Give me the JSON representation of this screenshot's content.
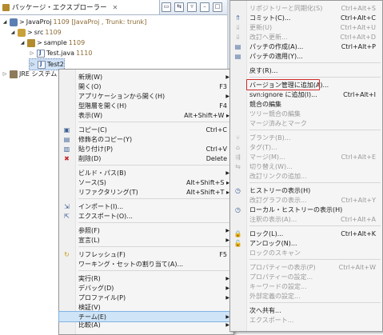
{
  "view": {
    "title": "パッケージ・エクスプローラー",
    "close": "✕"
  },
  "tree": {
    "project": {
      "prefix": "> ",
      "name": "JavaProj",
      "rev": "1109 [JavaProj , Trunk: trunk]"
    },
    "src": {
      "prefix": "> ",
      "name": "src",
      "rev": "1109"
    },
    "pkg": {
      "prefix": "> ",
      "name": "sample",
      "rev": "1109"
    },
    "file1": {
      "name": "Test.java",
      "rev": "1110"
    },
    "file2": {
      "name": "Test2"
    },
    "jre": {
      "name": "JRE システム"
    }
  },
  "main_menu": {
    "items": [
      {
        "label": "新規(W)",
        "shortcut": "",
        "sub": true
      },
      {
        "label": "開く(O)",
        "shortcut": "F3"
      },
      {
        "label": "アプリケーションから開く(H)",
        "shortcut": "",
        "sub": true
      },
      {
        "label": "型階層を開く(H)",
        "shortcut": "F4"
      },
      {
        "label": "表示(W)",
        "shortcut": "Alt+Shift+W ▸"
      },
      {
        "label": "コピー(C)",
        "shortcut": "Ctrl+C"
      },
      {
        "label": "修飾名のコピー(Y)",
        "shortcut": ""
      },
      {
        "label": "貼り付け(P)",
        "shortcut": "Ctrl+V"
      },
      {
        "label": "削除(D)",
        "shortcut": "Delete"
      },
      {
        "label": "ビルド・パス(B)",
        "shortcut": "",
        "sub": true
      },
      {
        "label": "ソース(S)",
        "shortcut": "Alt+Shift+S ▸"
      },
      {
        "label": "リファクタリング(T)",
        "shortcut": "Alt+Shift+T ▸"
      },
      {
        "label": "インポート(I)...",
        "shortcut": ""
      },
      {
        "label": "エクスポート(O)...",
        "shortcut": ""
      },
      {
        "label": "参照(F)",
        "shortcut": "",
        "sub": true
      },
      {
        "label": "宣言(L)",
        "shortcut": "",
        "sub": true
      },
      {
        "label": "リフレッシュ(F)",
        "shortcut": "F5"
      },
      {
        "label": "ワーキング・セットの割り当て(A)...",
        "shortcut": ""
      },
      {
        "label": "実行(R)",
        "shortcut": "",
        "sub": true
      },
      {
        "label": "デバッグ(D)",
        "shortcut": "",
        "sub": true
      },
      {
        "label": "プロファイル(P)",
        "shortcut": "",
        "sub": true
      },
      {
        "label": "検証(V)",
        "shortcut": ""
      },
      {
        "label": "チーム(E)",
        "shortcut": "",
        "sub": true
      },
      {
        "label": "比較(A)",
        "shortcut": "",
        "sub": true
      }
    ]
  },
  "team_menu": {
    "items": [
      {
        "label": "リポジトリーと同期化(S)",
        "shortcut": "Ctrl+Alt+S",
        "dis": true
      },
      {
        "label": "コミット(C)...",
        "shortcut": "Ctrl+Alt+C"
      },
      {
        "label": "更新(U)",
        "shortcut": "Ctrl+Alt+U",
        "dis": true
      },
      {
        "label": "改訂へ更新...",
        "shortcut": "Ctrl+Alt+D",
        "dis": true
      },
      {
        "label": "パッチの作成(A)...",
        "shortcut": "Ctrl+Alt+P"
      },
      {
        "label": "パッチの適用(Y)...",
        "shortcut": ""
      },
      {
        "label": "戻す(R)...",
        "shortcut": ""
      },
      {
        "label": "バージョン管理に追加(A)...",
        "shortcut": ""
      },
      {
        "label": "svn:ignore に追加(I)...",
        "shortcut": "Ctrl+Alt+I"
      },
      {
        "label": "競合の編集",
        "shortcut": ""
      },
      {
        "label": "ツリー競合の編集",
        "shortcut": "",
        "dis": true
      },
      {
        "label": "マージ済みとマーク",
        "shortcut": "",
        "dis": true
      },
      {
        "label": "ブランチ(B)...",
        "shortcut": "",
        "dis": true
      },
      {
        "label": "タグ(T)...",
        "shortcut": "",
        "dis": true
      },
      {
        "label": "マージ(M)...",
        "shortcut": "Ctrl+Alt+E",
        "dis": true
      },
      {
        "label": "切り替え(W)...",
        "shortcut": "",
        "dis": true
      },
      {
        "label": "改訂リンクの追加...",
        "shortcut": "",
        "dis": true
      },
      {
        "label": "ヒストリーの表示(H)",
        "shortcut": ""
      },
      {
        "label": "改訂グラフの表示...",
        "shortcut": "Ctrl+Alt+Y",
        "dis": true
      },
      {
        "label": "ローカル・ヒストリーの表示(H)",
        "shortcut": ""
      },
      {
        "label": "注釈の表示(A)...",
        "shortcut": "Ctrl+Alt+A",
        "dis": true
      },
      {
        "label": "ロック(L)...",
        "shortcut": "Ctrl+Alt+K"
      },
      {
        "label": "アンロック(N)...",
        "shortcut": ""
      },
      {
        "label": "ロックのスキャン",
        "shortcut": "",
        "dis": true
      },
      {
        "label": "プロパティーの表示(P)",
        "shortcut": "Ctrl+Alt+W",
        "dis": true
      },
      {
        "label": "プロパティーの設定...",
        "shortcut": "",
        "dis": true
      },
      {
        "label": "キーワードの設定...",
        "shortcut": "",
        "dis": true
      },
      {
        "label": "外部定義の設定...",
        "shortcut": "",
        "dis": true
      },
      {
        "label": "次へ共有...",
        "shortcut": ""
      },
      {
        "label": "エクスポート...",
        "shortcut": "",
        "dis": true
      }
    ]
  },
  "colors": {
    "highlight_border": "#d22a2a",
    "menu_bg": "#f5f5f5",
    "selection": "#cfe1f5"
  }
}
